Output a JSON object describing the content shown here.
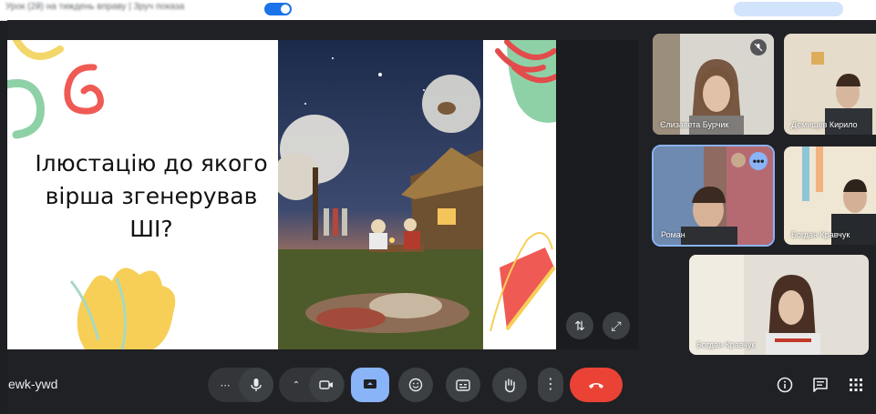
{
  "topbar": {
    "faded_text": "Урок (2й) на тиждень вправу  |  Зруч показа"
  },
  "slide": {
    "title_lines": [
      "Ілюстацію до якого",
      "вірша згенерував",
      "ШІ?"
    ]
  },
  "meeting": {
    "code": "ewk-ywd"
  },
  "participants": [
    {
      "name": "Єлизавета Бурчик",
      "muted": true
    },
    {
      "name": "Демищев Кирило"
    },
    {
      "name": "Роман",
      "active": true
    },
    {
      "name": "Богдан Кравчук"
    },
    {
      "name": "Богдан Кравчук"
    }
  ],
  "controls": {
    "more_options": "more-vert-icon",
    "end_call_color": "#ea4335",
    "present_active_color": "#8ab4f8"
  },
  "colors": {
    "background": "#202124",
    "tile": "#3c4043",
    "accent": "#8ab4f8"
  }
}
